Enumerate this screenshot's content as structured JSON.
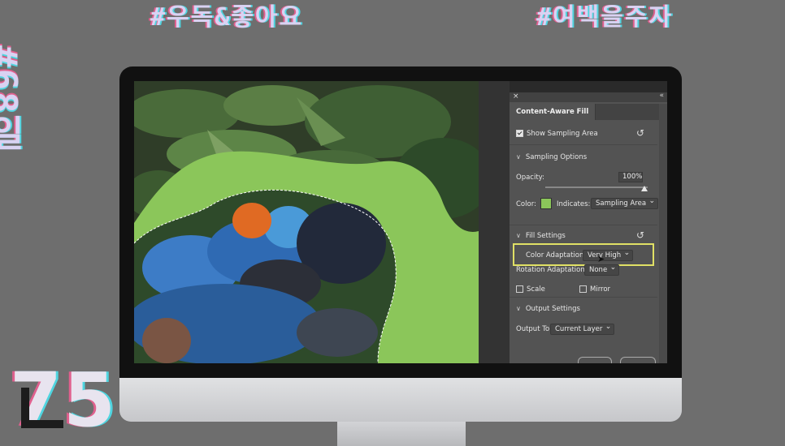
{
  "background": {
    "glitch_top_left": "#우독&좋아요",
    "glitch_top_right": "#여백을주자",
    "glitch_side": "#68일",
    "glitch_number": "75",
    "colors": {
      "accent_green": "#8bc65a",
      "highlight": "#e0e065"
    }
  },
  "panel": {
    "close_icon": "×",
    "collapse_icon": "«",
    "title": "Content-Aware Fill",
    "show_sampling_area": {
      "label": "Show Sampling Area",
      "checked": true
    },
    "sampling_options": {
      "header": "Sampling Options",
      "opacity_label": "Opacity:",
      "opacity_value": "100%",
      "opacity_level": 1.0,
      "color_label": "Color:",
      "indicates_label": "Indicates:",
      "indicates_value": "Sampling Area"
    },
    "fill_settings": {
      "header": "Fill Settings",
      "color_adaptation_label": "Color Adaptation:",
      "color_adaptation_value": "Very High",
      "rotation_adaptation_label": "Rotation Adaptation:",
      "rotation_adaptation_value": "None",
      "scale_label": "Scale",
      "scale_checked": false,
      "mirror_label": "Mirror",
      "mirror_checked": false
    },
    "output_settings": {
      "header": "Output Settings",
      "output_to_label": "Output To:",
      "output_to_value": "Current Layer"
    }
  }
}
